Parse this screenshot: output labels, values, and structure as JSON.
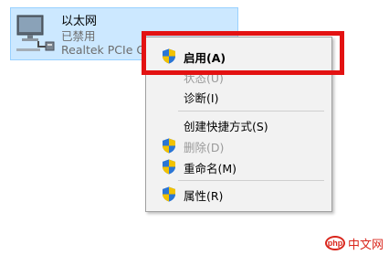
{
  "adapter": {
    "name": "以太网",
    "status": "已禁用",
    "device": "Realtek PCIe GbE"
  },
  "context_menu": {
    "items": [
      {
        "label": "启用(A)",
        "icon": "shield-icon",
        "enabled": true,
        "emphasized": true
      },
      {
        "label": "状态(U)",
        "icon": "",
        "enabled": false
      },
      {
        "label": "诊断(I)",
        "icon": "",
        "enabled": true
      },
      {
        "label": "创建快捷方式(S)",
        "icon": "",
        "enabled": true
      },
      {
        "label": "删除(D)",
        "icon": "shield-icon",
        "enabled": false
      },
      {
        "label": "重命名(M)",
        "icon": "shield-icon",
        "enabled": true
      },
      {
        "label": "属性(R)",
        "icon": "shield-icon",
        "enabled": true
      }
    ]
  },
  "watermark": {
    "badge": "php",
    "text": "中文网"
  },
  "colors": {
    "selection_bg": "#cce8ff",
    "selection_border": "#99d1ff",
    "menu_bg": "#f2f2f2",
    "highlight_box": "#e31212",
    "watermark": "#d9261c"
  }
}
